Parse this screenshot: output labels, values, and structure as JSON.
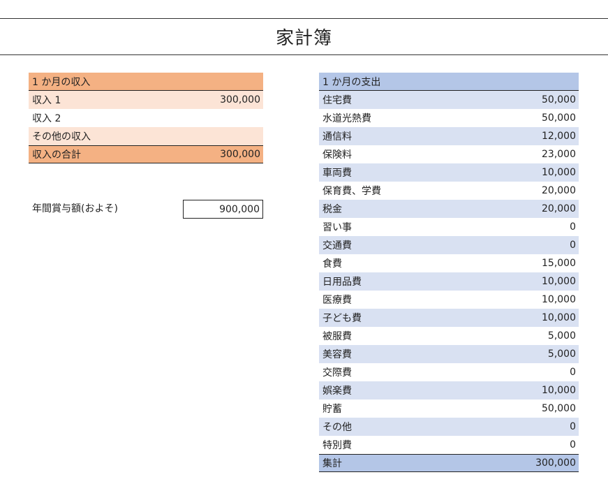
{
  "title": "家計簿",
  "income": {
    "header": "1 か月の収入",
    "rows": [
      {
        "label": "収入 1",
        "value": "300,000"
      },
      {
        "label": "収入 2",
        "value": ""
      },
      {
        "label": "その他の収入",
        "value": ""
      }
    ],
    "total": {
      "label": "収入の合計",
      "value": "300,000"
    }
  },
  "bonus": {
    "label": "年間賞与額(およそ)",
    "value": "900,000"
  },
  "expenses": {
    "header": "1 か月の支出",
    "rows": [
      {
        "label": "住宅費",
        "value": "50,000"
      },
      {
        "label": "水道光熱費",
        "value": "50,000"
      },
      {
        "label": "通信料",
        "value": "12,000"
      },
      {
        "label": "保険料",
        "value": "23,000"
      },
      {
        "label": "車両費",
        "value": "10,000"
      },
      {
        "label": "保育費、学費",
        "value": "20,000"
      },
      {
        "label": "税金",
        "value": "20,000"
      },
      {
        "label": "習い事",
        "value": "0"
      },
      {
        "label": "交通費",
        "value": "0"
      },
      {
        "label": "食費",
        "value": "15,000"
      },
      {
        "label": "日用品費",
        "value": "10,000"
      },
      {
        "label": "医療費",
        "value": "10,000"
      },
      {
        "label": "子ども費",
        "value": "10,000"
      },
      {
        "label": "被服費",
        "value": "5,000"
      },
      {
        "label": "美容費",
        "value": "5,000"
      },
      {
        "label": "交際費",
        "value": "0"
      },
      {
        "label": "娯楽費",
        "value": "10,000"
      },
      {
        "label": "貯蓄",
        "value": "50,000"
      },
      {
        "label": "その他",
        "value": "0"
      },
      {
        "label": "特別費",
        "value": "0"
      }
    ],
    "total": {
      "label": "集計",
      "value": "300,000"
    }
  }
}
